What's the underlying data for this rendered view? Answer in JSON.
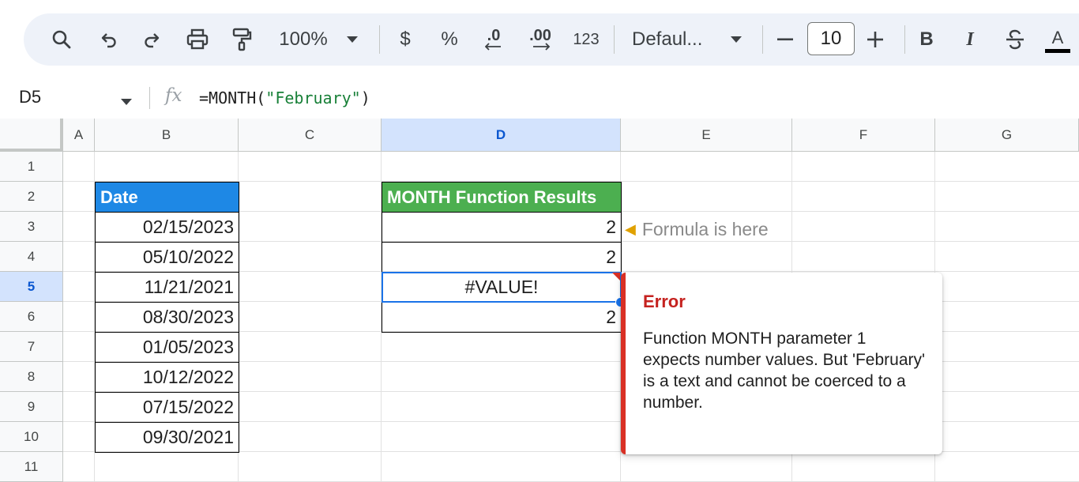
{
  "toolbar": {
    "zoom": "100%",
    "currency": "$",
    "percent": "%",
    "decrease_decimal": ".0",
    "increase_decimal": ".00",
    "number_format": "123",
    "font": "Defaul...",
    "font_size": "10",
    "bold": "B",
    "italic": "I",
    "text_color": "A"
  },
  "formula_bar": {
    "cell_ref": "D5",
    "fx": "fx",
    "formula_prefix": "=MONTH(",
    "formula_arg": "\"February\"",
    "formula_suffix": ")"
  },
  "columns": [
    "A",
    "B",
    "C",
    "D",
    "E",
    "F",
    "G"
  ],
  "rows": [
    "1",
    "2",
    "3",
    "4",
    "5",
    "6",
    "7",
    "8",
    "9",
    "10",
    "11"
  ],
  "selected_cell": {
    "column": "D",
    "row": "5"
  },
  "date_header": "Date",
  "dates": [
    "02/15/2023",
    "05/10/2022",
    "11/21/2021",
    "08/30/2023",
    "01/05/2023",
    "10/12/2022",
    "07/15/2022",
    "09/30/2021"
  ],
  "results_header": "MONTH Function Results",
  "results": [
    "2",
    "2",
    "#VALUE!",
    "2"
  ],
  "note": "Formula is here",
  "error": {
    "title": "Error",
    "message": "Function MONTH parameter 1 expects number values. But 'February' is a text and cannot be coerced to a number."
  },
  "colors": {
    "date_header_bg": "#1e88e5",
    "results_header_bg": "#4caf50",
    "error_accent": "#d93025",
    "selection": "#1a73e8"
  }
}
